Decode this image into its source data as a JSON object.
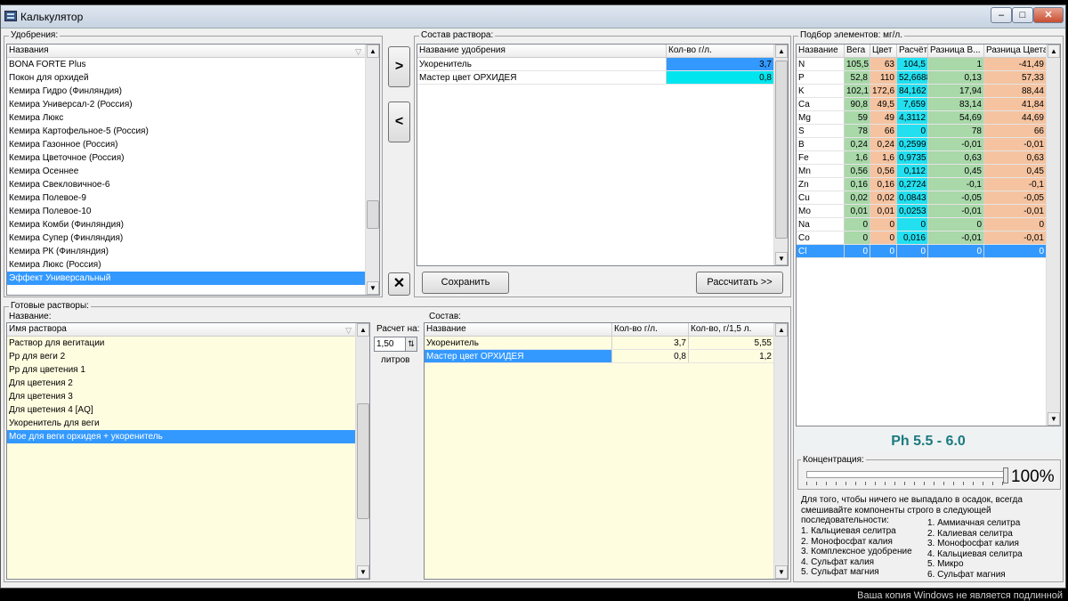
{
  "window": {
    "title": "Калькулятор"
  },
  "fertilizers": {
    "group_label": "Удобрения:",
    "header": "Названия",
    "items": [
      "BONA FORTE Plus",
      "Покон для орхидей",
      "Кемира Гидро (Финляндия)",
      "Кемира Универсал-2  (Россия)",
      "Кемира Люкс",
      "Кемира Картофельное-5 (Россия)",
      "Кемира Газонное (Россия)",
      "Кемира Цветочное (Россия)",
      "Кемира Осеннее",
      "Кемира Свекловичное-6",
      "Кемира Полевое-9",
      "Кемира Полевое-10",
      "Кемира Комби (Финляндия)",
      "Кемира Супер (Финляндия)",
      "Кемира РК (Финляндия)",
      "Кемира Люкс (Россия)",
      "Эффект Универсальный"
    ],
    "selected_index": 16
  },
  "transfer": {
    "add": ">",
    "remove": "<",
    "delete": "✕"
  },
  "composition": {
    "group_label": "Состав раствора:",
    "headers": [
      "Название удобрения",
      "Кол-во г/л."
    ],
    "rows": [
      {
        "name": "Укоренитель",
        "amount": "3,7",
        "color": "#3399ff"
      },
      {
        "name": "Мастер цвет ОРХИДЕЯ",
        "amount": "0,8",
        "color": "#00e5ee"
      }
    ],
    "save_label": "Сохранить",
    "calc_label": "Рассчитать >>"
  },
  "elements": {
    "group_label": "Подбор элементов: мг/л.",
    "headers": [
      "Название",
      "Вега",
      "Цвет",
      "Расчёт",
      "Разница В...",
      "Разница Цвета"
    ],
    "rows": [
      [
        "N",
        "105,5",
        "63",
        "104,5",
        "1",
        "-41,49"
      ],
      [
        "P",
        "52,8",
        "110",
        "52,6688",
        "0,13",
        "57,33"
      ],
      [
        "K",
        "102,1",
        "172,6",
        "84,162",
        "17,94",
        "88,44"
      ],
      [
        "Ca",
        "90,8",
        "49,5",
        "7,659",
        "83,14",
        "41,84"
      ],
      [
        "Mg",
        "59",
        "49",
        "4,3112",
        "54,69",
        "44,69"
      ],
      [
        "S",
        "78",
        "66",
        "0",
        "78",
        "66"
      ],
      [
        "B",
        "0,24",
        "0,24",
        "0,2599",
        "-0,01",
        "-0,01"
      ],
      [
        "Fe",
        "1,6",
        "1,6",
        "0,9735",
        "0,63",
        "0,63"
      ],
      [
        "Mn",
        "0,56",
        "0,56",
        "0,112",
        "0,45",
        "0,45"
      ],
      [
        "Zn",
        "0,16",
        "0,16",
        "0,2724",
        "-0,1",
        "-0,1"
      ],
      [
        "Cu",
        "0,02",
        "0,02",
        "0,0843",
        "-0,05",
        "-0,05"
      ],
      [
        "Mo",
        "0,01",
        "0,01",
        "0,0253",
        "-0,01",
        "-0,01"
      ],
      [
        "Na",
        "0",
        "0",
        "0",
        "0",
        "0"
      ],
      [
        "Co",
        "0",
        "0",
        "0,016",
        "-0,01",
        "-0,01"
      ],
      [
        "Cl",
        "0",
        "0",
        "0",
        "0",
        "0"
      ]
    ],
    "selected_index": 14,
    "colors": {
      "vega": "#a9d8a9",
      "color": "#f5c3a0",
      "calc": "#22e0f0"
    }
  },
  "ph": {
    "label": "Ph 5.5 - 6.0"
  },
  "concentration": {
    "group_label": "Концентрация:",
    "value_label": "100%",
    "level": 1.0
  },
  "instructions": {
    "intro": [
      "Для того, чтобы ничего не выпадало в осадок, всегда",
      "смешивайте компоненты строго в следующей",
      "последовательности:"
    ],
    "left": [
      "1. Кальциевая селитра",
      "2. Монофосфат калия",
      "3. Комплексное удобрение",
      "4. Сульфат калия",
      "5. Сульфат магния"
    ],
    "right": [
      "1. Аммиачная селитра",
      "2. Калиевая селитра",
      "3. Монофосфат калия",
      "4. Кальциевая селитра",
      "5. Микро",
      "6. Сульфат магния"
    ]
  },
  "ready": {
    "group_label": "Готовые растворы:",
    "sub_label": "Название:",
    "header": "Имя раствора",
    "items": [
      "Раствор для вегитации",
      "Рр для веги 2",
      "Рр для цветения 1",
      "Для цветения 2",
      "Для цветения 3",
      "Для цветения 4 [AQ]",
      "Укоренитель для веги",
      "Мое для веги орхидея + укоренитель"
    ],
    "selected_index": 7
  },
  "calc_for": {
    "label": "Расчет на:",
    "value": "1,50",
    "unit": "литров"
  },
  "solution": {
    "group_label": "Состав:",
    "headers": [
      "Название",
      "Кол-во г/л.",
      "Кол-во, г/1,5 л."
    ],
    "rows": [
      [
        "Укоренитель",
        "3,7",
        "5,55"
      ],
      [
        "Мастер цвет ОРХИДЕЯ",
        "0,8",
        "1,2"
      ]
    ],
    "selected_index": 1
  },
  "watermark": "Ваша копия Windows не является подлинной"
}
